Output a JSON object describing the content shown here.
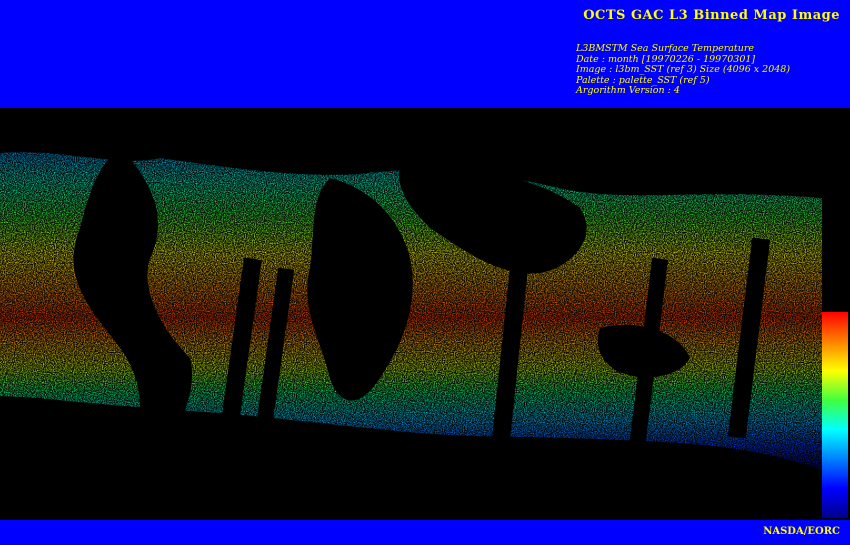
{
  "header": {
    "title": "OCTS GAC L3 Binned Map Image",
    "meta_lines": [
      "L3BMSTM Sea Surface Temperature",
      "Date : month [19970226 - 19970301]",
      "Image : l3bm_SST (ref 3) Size (4096 x 2048)",
      "Palette : palette_SST (ref 5)",
      "Argorithm Version : 4"
    ]
  },
  "map": {
    "variable": "Sea Surface Temperature",
    "colors": {
      "background": "#000000",
      "hot": "#ff0000",
      "warm": "#ffff00",
      "mid": "#40ff40",
      "cool": "#00ffff",
      "cold": "#0000ff"
    }
  },
  "colorbar": {
    "colors": [
      "#ff0000",
      "#ff8000",
      "#ffff00",
      "#40ff40",
      "#00ffff",
      "#0080ff",
      "#0000ff",
      "#00008b"
    ]
  },
  "footer": {
    "credit": "NASDA/EORC"
  },
  "colors": {
    "banner": "#0000ff",
    "text": "#ffff00"
  }
}
